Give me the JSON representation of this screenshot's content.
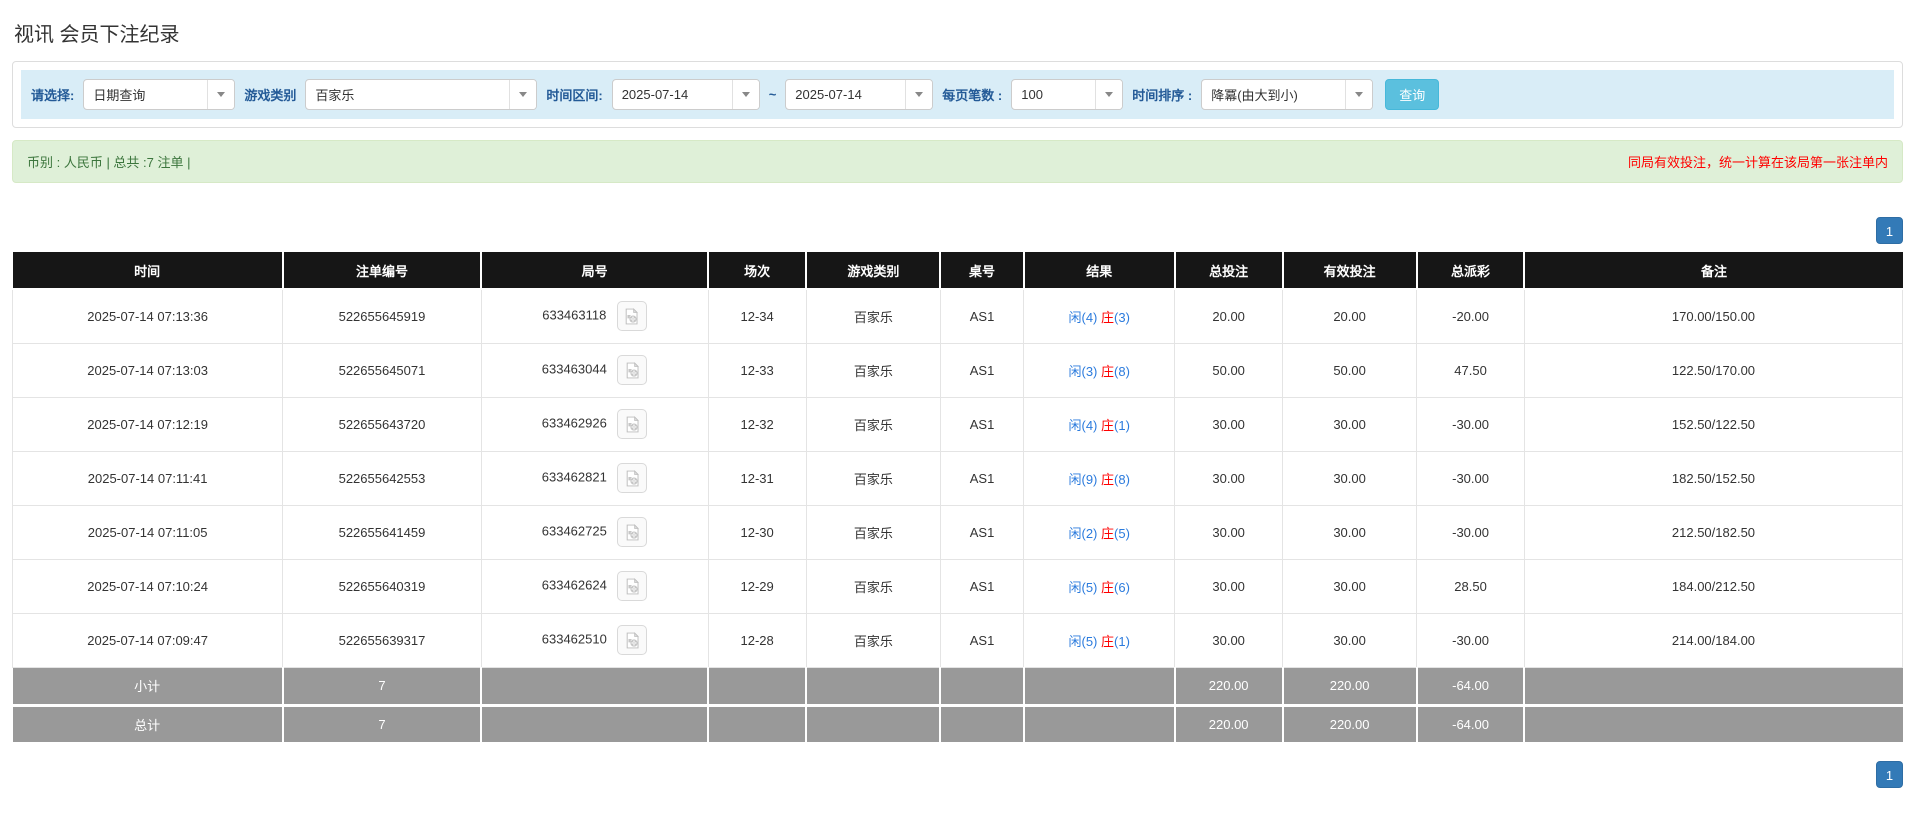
{
  "page": {
    "title": "视讯 会员下注纪录"
  },
  "filters": {
    "select_label": "请选择:",
    "select_value": "日期查询",
    "game_type_label": "游戏类别",
    "game_type_value": "百家乐",
    "date_range_label": "时间区间:",
    "date_from": "2025-07-14",
    "date_separator": "~",
    "date_to": "2025-07-14",
    "page_size_label": "每页笔数 :",
    "page_size_value": "100",
    "sort_label": "时间排序 :",
    "sort_value": "降冪(由大到小)",
    "search_button": "查询"
  },
  "summary_bar": {
    "left_text": "币别 : 人民币 | 总共 :7 注单 |",
    "right_notice": "同局有效投注，统一计算在该局第一张注单内"
  },
  "pagination": {
    "page": "1"
  },
  "table": {
    "headers": [
      "时间",
      "注单编号",
      "局号",
      "场次",
      "游戏类别",
      "桌号",
      "结果",
      "总投注",
      "有效投注",
      "总派彩",
      "备注"
    ],
    "rows": [
      {
        "time": "2025-07-14 07:13:36",
        "bet_id": "522655645919",
        "round_id": "633463118",
        "session": "12-34",
        "game_type": "百家乐",
        "table_id": "AS1",
        "result": {
          "player": "闲(4)",
          "banker": "庄",
          "banker_score": "(3)"
        },
        "total_bet": "20.00",
        "valid_bet": "20.00",
        "payout": "-20.00",
        "remark": "170.00/150.00"
      },
      {
        "time": "2025-07-14 07:13:03",
        "bet_id": "522655645071",
        "round_id": "633463044",
        "session": "12-33",
        "game_type": "百家乐",
        "table_id": "AS1",
        "result": {
          "player": "闲(3)",
          "banker": "庄",
          "banker_score": "(8)"
        },
        "total_bet": "50.00",
        "valid_bet": "50.00",
        "payout": "47.50",
        "remark": "122.50/170.00"
      },
      {
        "time": "2025-07-14 07:12:19",
        "bet_id": "522655643720",
        "round_id": "633462926",
        "session": "12-32",
        "game_type": "百家乐",
        "table_id": "AS1",
        "result": {
          "player": "闲(4)",
          "banker": "庄",
          "banker_score": "(1)"
        },
        "total_bet": "30.00",
        "valid_bet": "30.00",
        "payout": "-30.00",
        "remark": "152.50/122.50"
      },
      {
        "time": "2025-07-14 07:11:41",
        "bet_id": "522655642553",
        "round_id": "633462821",
        "session": "12-31",
        "game_type": "百家乐",
        "table_id": "AS1",
        "result": {
          "player": "闲(9)",
          "banker": "庄",
          "banker_score": "(8)"
        },
        "total_bet": "30.00",
        "valid_bet": "30.00",
        "payout": "-30.00",
        "remark": "182.50/152.50"
      },
      {
        "time": "2025-07-14 07:11:05",
        "bet_id": "522655641459",
        "round_id": "633462725",
        "session": "12-30",
        "game_type": "百家乐",
        "table_id": "AS1",
        "result": {
          "player": "闲(2)",
          "banker": "庄",
          "banker_score": "(5)"
        },
        "total_bet": "30.00",
        "valid_bet": "30.00",
        "payout": "-30.00",
        "remark": "212.50/182.50"
      },
      {
        "time": "2025-07-14 07:10:24",
        "bet_id": "522655640319",
        "round_id": "633462624",
        "session": "12-29",
        "game_type": "百家乐",
        "table_id": "AS1",
        "result": {
          "player": "闲(5)",
          "banker": "庄",
          "banker_score": "(6)"
        },
        "total_bet": "30.00",
        "valid_bet": "30.00",
        "payout": "28.50",
        "remark": "184.00/212.50"
      },
      {
        "time": "2025-07-14 07:09:47",
        "bet_id": "522655639317",
        "round_id": "633462510",
        "session": "12-28",
        "game_type": "百家乐",
        "table_id": "AS1",
        "result": {
          "player": "闲(5)",
          "banker": "庄",
          "banker_score": "(1)"
        },
        "total_bet": "30.00",
        "valid_bet": "30.00",
        "payout": "-30.00",
        "remark": "214.00/184.00"
      }
    ],
    "subtotal": {
      "label": "小计",
      "count": "7",
      "total_bet": "220.00",
      "valid_bet": "220.00",
      "payout": "-64.00"
    },
    "total": {
      "label": "总计",
      "count": "7",
      "total_bet": "220.00",
      "valid_bet": "220.00",
      "payout": "-64.00"
    }
  },
  "colors": {
    "filter_bar_bg": "#d9edf7",
    "filter_label": "#235a97",
    "search_button_bg": "#5bc0de",
    "alert_bg": "#dff0d8",
    "alert_text": "#3c763d",
    "notice_red": "#ff0000",
    "header_bg": "#161616",
    "summary_bg": "#999999",
    "link_blue": "#2b7bdd",
    "pagination_bg": "#337ab7"
  }
}
